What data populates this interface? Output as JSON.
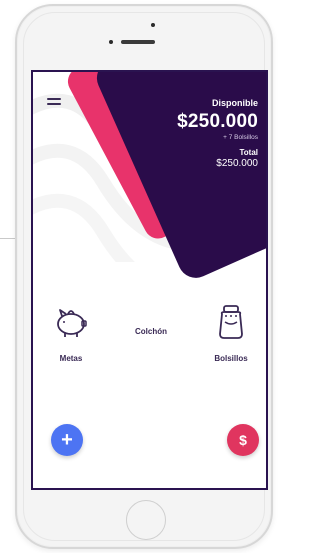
{
  "balance": {
    "available_label": "Disponible",
    "available_amount": "$250.000",
    "pockets_note": "+ 7 Bolsillos",
    "total_label": "Total",
    "total_amount": "$250.000"
  },
  "nav": {
    "metas": "Metas",
    "colchon": "Colchón",
    "bolsillos": "Bolsillos"
  },
  "actions": {
    "add_symbol": "+",
    "money_symbol": "$"
  },
  "colors": {
    "dark_purple": "#2a0c4a",
    "pink": "#e8336b",
    "blue_fab": "#4d74f3",
    "red_fab": "#e0355f"
  },
  "icons": {
    "menu": "menu-icon",
    "metas": "piggy-bank-icon",
    "bolsillos": "jar-icon"
  }
}
